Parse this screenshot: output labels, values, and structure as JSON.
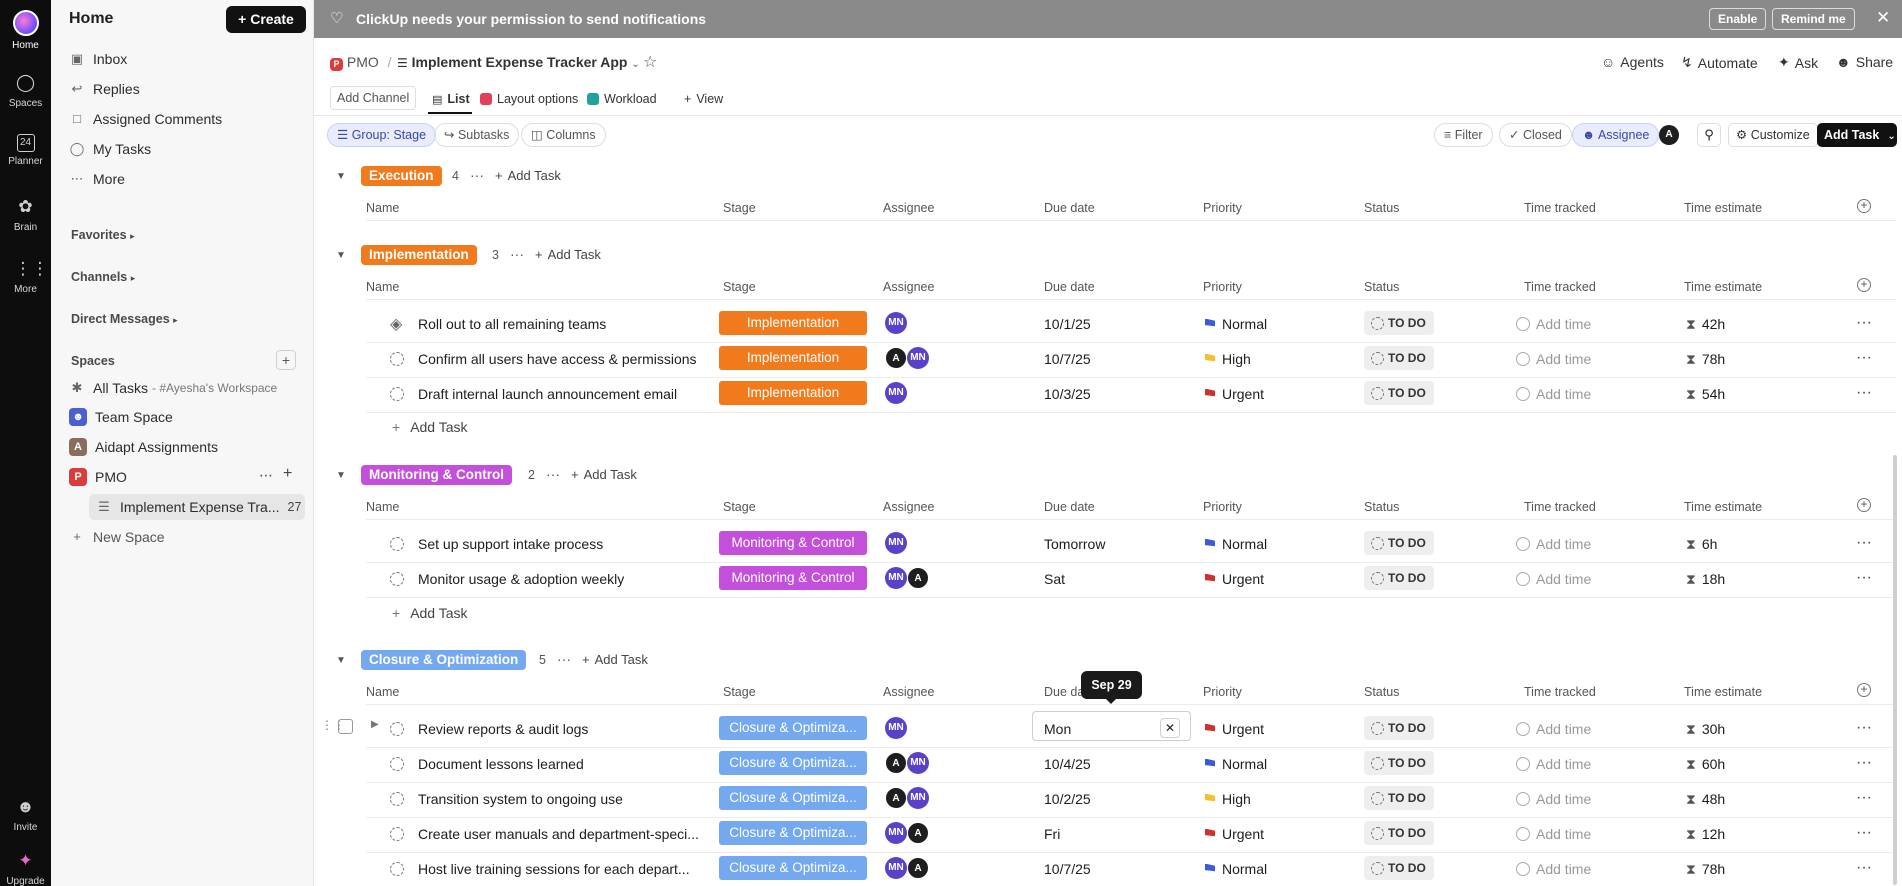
{
  "rail": {
    "home": "Home",
    "spaces": "Spaces",
    "planner": "Planner",
    "planner_day": "24",
    "brain": "Brain",
    "more": "More",
    "invite": "Invite",
    "upgrade": "Upgrade"
  },
  "sidebar": {
    "title": "Home",
    "create": "Create",
    "items": [
      {
        "label": "Inbox",
        "icon": "inbox-icon"
      },
      {
        "label": "Replies",
        "icon": "reply-icon"
      },
      {
        "label": "Assigned Comments",
        "icon": "comment-icon"
      },
      {
        "label": "My Tasks",
        "icon": "user-icon"
      },
      {
        "label": "More",
        "icon": "ellipsis-icon"
      }
    ],
    "favorites": "Favorites",
    "channels": "Channels",
    "direct_messages": "Direct Messages",
    "spaces_header": "Spaces",
    "all_tasks": "All Tasks",
    "all_tasks_suffix": "- #Ayesha's Workspace",
    "spaces": [
      {
        "label": "Team Space",
        "letter": "",
        "color": "#4b5fd1"
      },
      {
        "label": "Aidapt Assignments",
        "letter": "A",
        "color": "#8a6d5f"
      },
      {
        "label": "PMO",
        "letter": "P",
        "color": "#d93c3c"
      }
    ],
    "list_item": "Implement Expense Tra...",
    "list_count": "27",
    "new_space": "New Space"
  },
  "banner": {
    "text": "ClickUp needs your permission to send notifications",
    "enable": "Enable",
    "remind": "Remind me"
  },
  "header": {
    "breadcrumb_space": "PMO",
    "breadcrumb_sep": "/",
    "list_title": "Implement Expense Tracker App",
    "agents": "Agents",
    "automate": "Automate",
    "ask": "Ask",
    "share": "Share"
  },
  "tabs": {
    "add_channel": "Add Channel",
    "list": "List",
    "layout": "Layout options",
    "workload": "Workload",
    "view": "View"
  },
  "toolbar": {
    "group": "Group: Stage",
    "subtasks": "Subtasks",
    "columns": "Columns",
    "filter": "Filter",
    "closed": "Closed",
    "assignee": "Assignee",
    "assignee_avatar": "A",
    "customize": "Customize",
    "add_task": "Add Task"
  },
  "columns": {
    "name": "Name",
    "stage": "Stage",
    "assignee": "Assignee",
    "due": "Due date",
    "due_short": "Due da",
    "priority": "Priority",
    "status": "Status",
    "time_tracked": "Time tracked",
    "time_estimate": "Time estimate"
  },
  "common": {
    "add_task": "Add Task",
    "add_time": "Add time",
    "todo": "TO DO",
    "dots": "···"
  },
  "groups": [
    {
      "name": "Execution",
      "count": "4",
      "color": "#f07a1c"
    },
    {
      "name": "Implementation",
      "count": "3",
      "color": "#f07a1c"
    },
    {
      "name": "Monitoring & Control",
      "count": "2",
      "color": "#c44fdb"
    },
    {
      "name": "Closure & Optimization",
      "count": "5",
      "color": "#74a9f0"
    }
  ],
  "tasks": {
    "implementation": [
      {
        "name": "Roll out to all remaining teams",
        "stage": "Implementation",
        "due": "10/1/25",
        "priority": "Normal",
        "estimate": "42h"
      },
      {
        "name": "Confirm all users have access & permissions",
        "stage": "Implementation",
        "due": "10/7/25",
        "priority": "High",
        "estimate": "78h"
      },
      {
        "name": "Draft internal launch announcement email",
        "stage": "Implementation",
        "due": "10/3/25",
        "priority": "Urgent",
        "estimate": "54h"
      }
    ],
    "monitoring": [
      {
        "name": "Set up support intake process",
        "stage": "Monitoring & Control",
        "due": "Tomorrow",
        "priority": "Normal",
        "estimate": "6h"
      },
      {
        "name": "Monitor usage & adoption weekly",
        "stage": "Monitoring & Control",
        "due": "Sat",
        "priority": "Urgent",
        "estimate": "18h"
      }
    ],
    "closure": [
      {
        "name": "Review reports & audit logs",
        "stage": "Closure & Optimiza...",
        "due": "Mon",
        "priority": "Urgent",
        "estimate": "30h"
      },
      {
        "name": "Document lessons learned",
        "stage": "Closure & Optimiza...",
        "due": "10/4/25",
        "priority": "Normal",
        "estimate": "60h"
      },
      {
        "name": "Transition system to ongoing use",
        "stage": "Closure & Optimiza...",
        "due": "10/2/25",
        "priority": "High",
        "estimate": "48h"
      },
      {
        "name": "Create user manuals and department-speci...",
        "stage": "Closure & Optimiza...",
        "due": "Fri",
        "priority": "Urgent",
        "estimate": "12h"
      },
      {
        "name": "Host live training sessions for each depart...",
        "stage": "Closure & Optimiza...",
        "due": "10/7/25",
        "priority": "Normal",
        "estimate": "78h"
      }
    ]
  },
  "avatars": {
    "mn": "MN",
    "a": "A"
  },
  "tooltip": "Sep 29",
  "colors": {
    "normal": "#3b5bdb",
    "high": "#f5c02f",
    "urgent": "#d32f2f"
  }
}
